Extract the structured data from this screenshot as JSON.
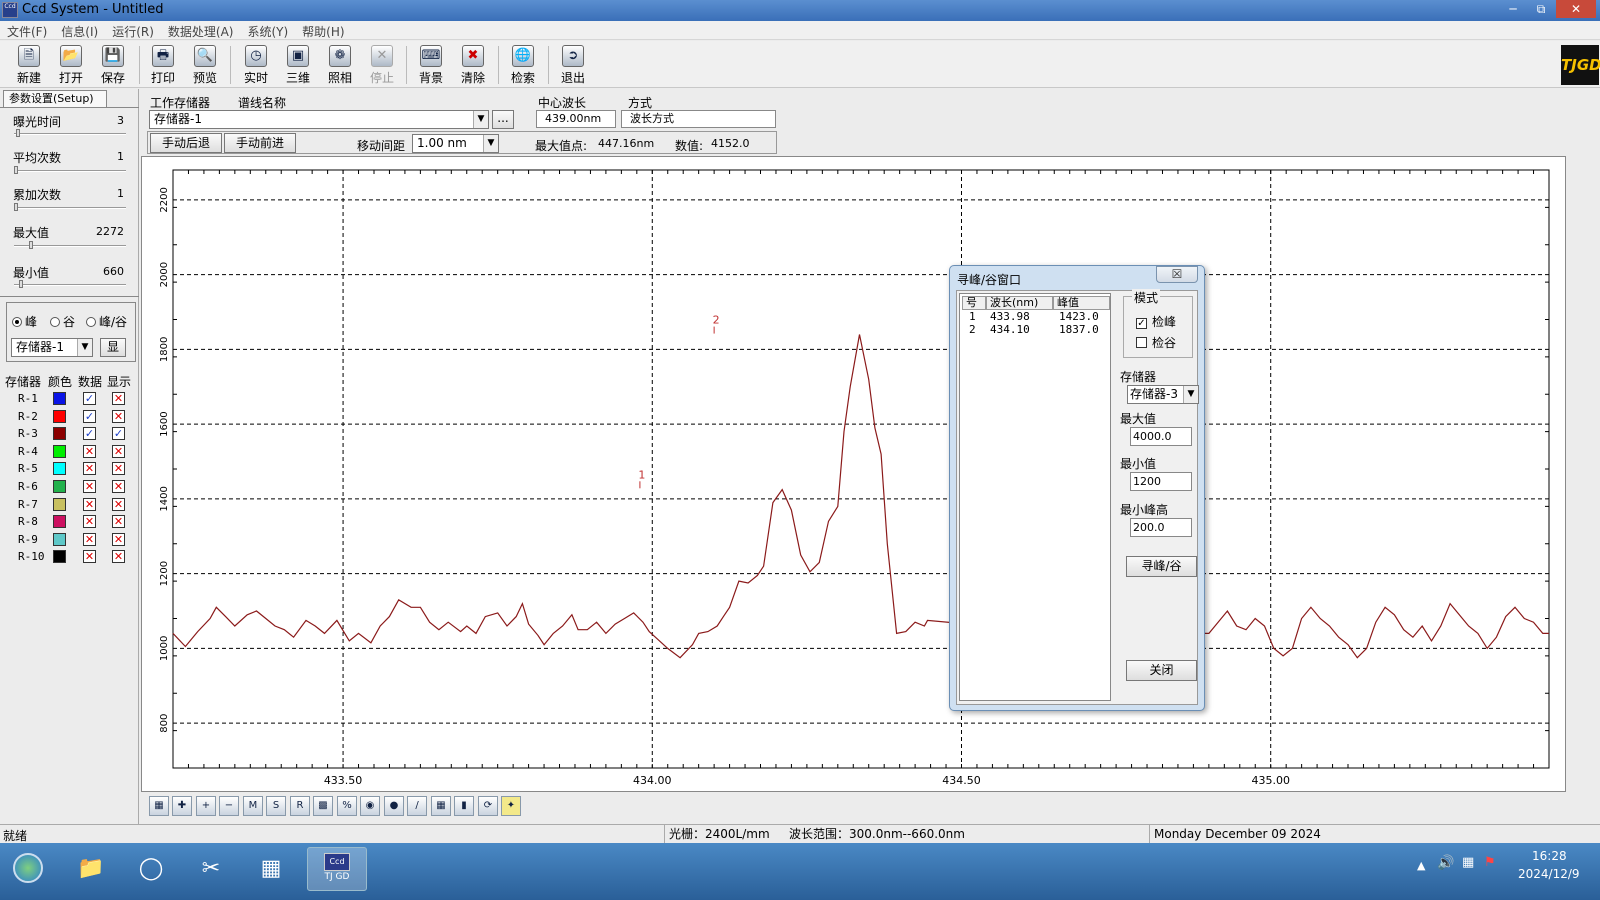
{
  "window": {
    "title": "Ccd System - Untitled",
    "icon_text": "Ccd"
  },
  "menu": [
    "文件(F)",
    "信息(I)",
    "运行(R)",
    "数据处理(A)",
    "系统(Y)",
    "帮助(H)"
  ],
  "toolbar": {
    "new": "新建",
    "open": "打开",
    "save": "保存",
    "print": "打印",
    "preview": "预览",
    "realtime": "实时",
    "threed": "三维",
    "photo": "照相",
    "stop": "停止",
    "background": "背景",
    "clear": "清除",
    "search": "检索",
    "exit": "退出",
    "logo": "TJGD"
  },
  "setup": {
    "tab": "参数设置(Setup)",
    "sliders": [
      {
        "label": "曝光时间",
        "value": "3",
        "level": 0.02
      },
      {
        "label": "平均次数",
        "value": "1",
        "level": 0.0
      },
      {
        "label": "累加次数",
        "value": "1",
        "level": 0.0
      },
      {
        "label": "最大值",
        "value": "2272",
        "level": 0.14
      },
      {
        "label": "最小值",
        "value": "660",
        "level": 0.05
      }
    ],
    "mode": {
      "peak": "峰",
      "valley": "谷",
      "peak_valley": "峰/谷",
      "selected": "peak"
    },
    "memory_select": "存储器-1",
    "show_button": "显"
  },
  "memory_table": {
    "headers": [
      "存储器",
      "颜色",
      "数据",
      "显示"
    ],
    "rows": [
      {
        "name": "R-1",
        "color": "#0a14e6",
        "data": true,
        "show": false
      },
      {
        "name": "R-2",
        "color": "#ff0000",
        "data": true,
        "show": false
      },
      {
        "name": "R-3",
        "color": "#8b0000",
        "data": true,
        "show": true
      },
      {
        "name": "R-4",
        "color": "#00ee00",
        "data": false,
        "show": false
      },
      {
        "name": "R-5",
        "color": "#00ffff",
        "data": false,
        "show": false
      },
      {
        "name": "R-6",
        "color": "#22b14c",
        "data": false,
        "show": false
      },
      {
        "name": "R-7",
        "color": "#c8c060",
        "data": false,
        "show": false
      },
      {
        "name": "R-8",
        "color": "#cc1060",
        "data": false,
        "show": false
      },
      {
        "name": "R-9",
        "color": "#5ec8c8",
        "data": false,
        "show": false
      },
      {
        "name": "R-10",
        "color": "#000000",
        "data": false,
        "show": false
      }
    ]
  },
  "fields": {
    "work_memory_label": "工作存储器",
    "line_name_label": "谱线名称",
    "work_memory_value": "存储器-1",
    "browse": "...",
    "center_wl_label": "中心波长",
    "center_wl_value": "439.00nm",
    "mode_label": "方式",
    "mode_value": "波长方式",
    "manual_back": "手动后退",
    "manual_forward": "手动前进",
    "move_step_label": "移动间距",
    "move_step_value": "1.00 nm",
    "max_point_label": "最大值点:",
    "max_point_value": "447.16nm",
    "value_label": "数值:",
    "value_value": "4152.0"
  },
  "chart_data": {
    "type": "line",
    "xlim": [
      433.225,
      435.45
    ],
    "ylim": [
      680,
      2280
    ],
    "xticks": [
      433.5,
      434.0,
      434.5,
      435.0
    ],
    "xtick_labels": [
      "433.50",
      "434.00",
      "434.50",
      "435.00"
    ],
    "yticks": [
      800,
      1000,
      1200,
      1400,
      1600,
      1800,
      2000,
      2200
    ],
    "ytick_labels": [
      "800",
      "1000",
      "1200",
      "1400",
      "1600",
      "1800",
      "2000",
      "2200"
    ],
    "grid": true,
    "series": [
      {
        "color": "#8b1a1a",
        "x": [
          433.225,
          433.245,
          433.265,
          433.285,
          433.295,
          433.31,
          433.325,
          433.345,
          433.36,
          433.375,
          433.39,
          433.405,
          433.42,
          433.44,
          433.455,
          433.47,
          433.49,
          433.51,
          433.525,
          433.545,
          433.56,
          433.575,
          433.59,
          433.61,
          433.625,
          433.64,
          433.655,
          433.67,
          433.69,
          433.7,
          433.715,
          433.73,
          433.75,
          433.765,
          433.78,
          433.79,
          433.8,
          433.815,
          433.825,
          433.84,
          433.855,
          433.87,
          433.88,
          433.895,
          433.91,
          433.925,
          433.94,
          433.955,
          433.97,
          433.985,
          433.995,
          434.005,
          434.025,
          434.045,
          434.065,
          434.075,
          434.09,
          434.105,
          434.115,
          434.125,
          434.14,
          434.155,
          434.17,
          434.18,
          434.195,
          434.21,
          434.225,
          434.24,
          434.255,
          434.27,
          434.285,
          434.3,
          434.31,
          434.32,
          434.335,
          434.35,
          434.36,
          434.37,
          434.38,
          434.395,
          434.41,
          434.425,
          434.44,
          434.445,
          434.545,
          434.56,
          434.575,
          434.59,
          434.605,
          434.62,
          434.635,
          434.65,
          434.665,
          434.675,
          434.69,
          434.705,
          434.72,
          434.735,
          434.75,
          434.765,
          434.78,
          434.795,
          434.81,
          434.825,
          434.84,
          434.855,
          434.87,
          434.885,
          434.9,
          434.915,
          434.93,
          434.945,
          434.96,
          434.975,
          434.99,
          435.005,
          435.02,
          435.035,
          435.05,
          435.065,
          435.08,
          435.095,
          435.11,
          435.125,
          435.14,
          435.155,
          435.17,
          435.185,
          435.2,
          435.215,
          435.23,
          435.245,
          435.26,
          435.275,
          435.29,
          435.305,
          435.32,
          435.335,
          435.35,
          435.365,
          435.38,
          435.395,
          435.41,
          435.425,
          435.44,
          435.45
        ],
        "y": [
          1040,
          1005,
          1045,
          1080,
          1110,
          1085,
          1060,
          1090,
          1100,
          1080,
          1060,
          1050,
          1030,
          1075,
          1060,
          1040,
          1075,
          1020,
          1040,
          1015,
          1060,
          1085,
          1130,
          1110,
          1110,
          1070,
          1050,
          1070,
          1045,
          1060,
          1040,
          1085,
          1095,
          1060,
          1085,
          1120,
          1065,
          1035,
          1010,
          1040,
          1060,
          1090,
          1050,
          1050,
          1070,
          1040,
          1065,
          1080,
          1095,
          1070,
          1045,
          1030,
          1000,
          975,
          1010,
          1040,
          1045,
          1060,
          1085,
          1110,
          1180,
          1175,
          1195,
          1220,
          1390,
          1425,
          1370,
          1250,
          1205,
          1230,
          1340,
          1380,
          1580,
          1700,
          1840,
          1720,
          1590,
          1520,
          1280,
          1040,
          1045,
          1070,
          1060,
          1075,
          1060,
          1040,
          1090,
          1110,
          1065,
          1070,
          1040,
          1075,
          1060,
          1070,
          1050,
          1080,
          1050,
          1065,
          1090,
          1060,
          1030,
          1050,
          1070,
          1090,
          1060,
          1040,
          1050,
          1040,
          1040,
          1070,
          1100,
          1060,
          1050,
          1080,
          1060,
          1000,
          980,
          1000,
          1080,
          1110,
          1080,
          1060,
          1030,
          1010,
          975,
          1000,
          1070,
          1110,
          1090,
          1050,
          1030,
          1060,
          1020,
          1060,
          1120,
          1090,
          1060,
          1040,
          1000,
          1030,
          1085,
          1110,
          1080,
          1070,
          1040,
          1040
        ],
        "peak_marks": [
          {
            "label": "1",
            "x": 433.98,
            "y": 1423
          },
          {
            "label": "2",
            "x": 434.1,
            "y": 1837
          }
        ]
      }
    ]
  },
  "dialog": {
    "title": "寻峰/谷窗口",
    "close_x": "☒",
    "headers": [
      "号",
      "波长(nm)",
      "峰值"
    ],
    "rows": [
      [
        "1",
        "433.98",
        "1423.0"
      ],
      [
        "2",
        "434.10",
        "1837.0"
      ]
    ],
    "mode_group": "模式",
    "find_peak": "检峰",
    "find_valley": "检谷",
    "memory_label": "存储器",
    "memory_value": "存储器-3",
    "max_label": "最大值",
    "max_value": "4000.0",
    "min_label": "最小值",
    "min_value": "1200",
    "min_height_label": "最小峰高",
    "min_height_value": "200.0",
    "search_button": "寻峰/谷",
    "close_button": "关闭"
  },
  "status": {
    "ready": "就绪",
    "grating": "光栅：2400L/mm",
    "range": "波长范围：300.0nm--660.0nm",
    "date": "Monday December 09 2024"
  },
  "taskbar": {
    "app_label": "TJ GD",
    "time": "16:28",
    "date": "2024/12/9"
  }
}
